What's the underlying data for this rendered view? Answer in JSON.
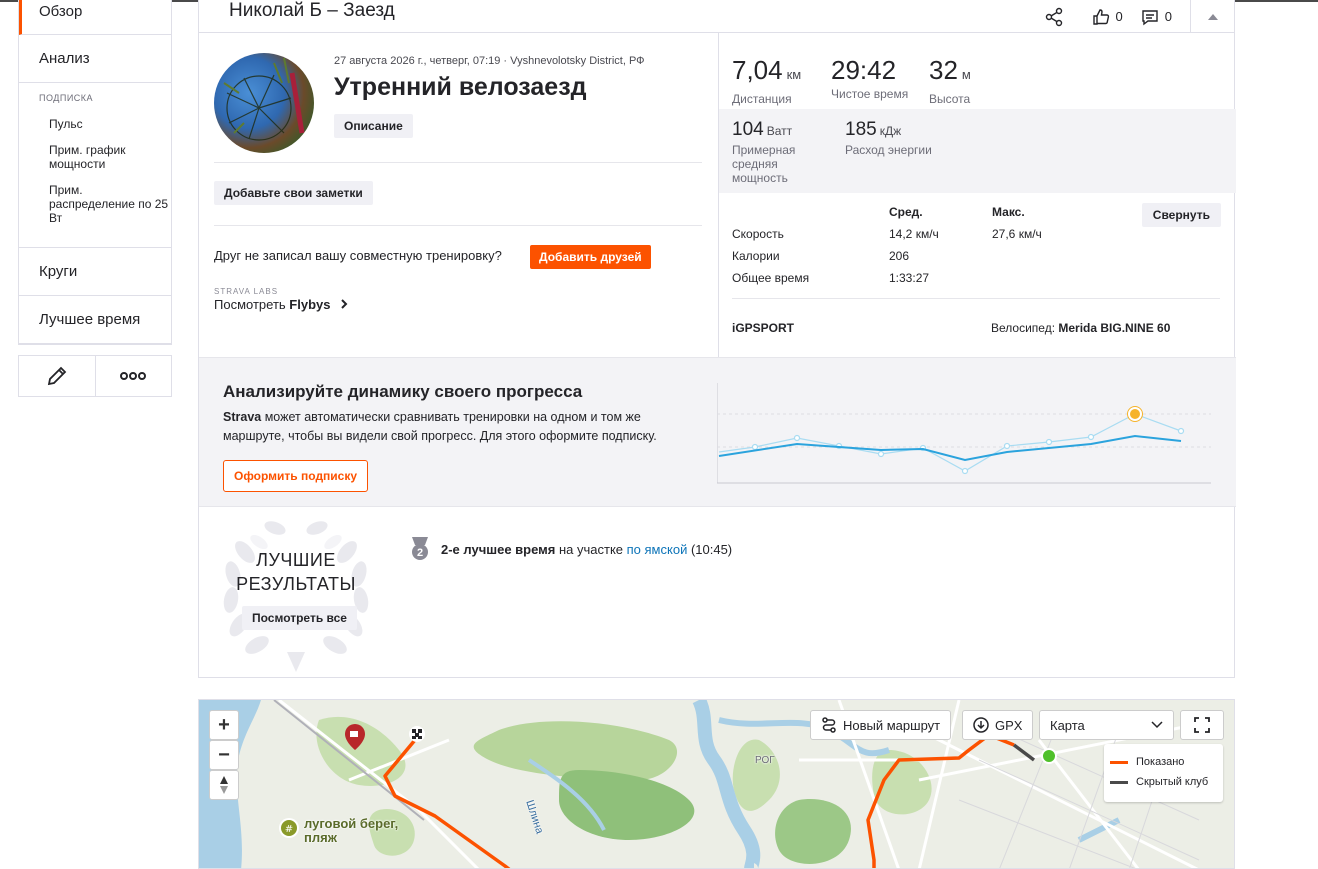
{
  "sidebar": {
    "overview": "Обзор",
    "analysis": "Анализ",
    "subscription_label": "ПОДПИСКА",
    "sub_items": [
      "Пульс",
      "Прим. график мощности",
      "Прим. распределение по 25 Вт"
    ],
    "laps": "Круги",
    "best_time": "Лучшее время"
  },
  "header": {
    "title": "Николай Б – Заезд",
    "kudos_count": "0",
    "comments_count": "0"
  },
  "activity": {
    "meta": "27 августа 2026 г., четверг, 07:19 · Vyshnevolotsky District, РФ",
    "title": "Утренний велозаезд",
    "description_btn": "Описание",
    "notes_btn": "Добавьте свои заметки",
    "friend_question": "Друг не записал вашу совместную тренировку?",
    "add_friends_btn": "Добавить друзей",
    "labs_label": "STRAVA LABS",
    "flybys_prefix": "Посмотреть ",
    "flybys_bold": "Flybys"
  },
  "stats": {
    "distance_val": "7,04",
    "distance_unit": "км",
    "distance_lbl": "Дистанция",
    "moving_val": "29:42",
    "moving_lbl": "Чистое время",
    "elev_val": "32",
    "elev_unit": "м",
    "elev_lbl": "Высота",
    "power_val": "104",
    "power_unit": "Ватт",
    "power_lbl": "Примерная средняя мощность",
    "energy_val": "185",
    "energy_unit": "кДж",
    "energy_lbl": "Расход энергии",
    "col_avg": "Сред.",
    "col_max": "Макс.",
    "collapse_btn": "Свернуть",
    "rows": [
      {
        "label": "Скорость",
        "avg": "14,2 км/ч",
        "max": "27,6 км/ч"
      },
      {
        "label": "Калории",
        "avg": "206",
        "max": ""
      },
      {
        "label": "Общее время",
        "avg": "1:33:27",
        "max": ""
      }
    ],
    "device": "iGPSPORT",
    "bike_label": "Велосипед: ",
    "bike_name": "Merida BIG.NINE 60"
  },
  "promo": {
    "title": "Анализируйте динамику своего прогресса",
    "text_bold": "Strava",
    "text_rest": " может автоматически сравнивать тренировки на одном и том же маршруте, чтобы вы видели свой прогресс. Для этого оформите подписку.",
    "button": "Оформить подписку"
  },
  "achievements": {
    "title_line1": "ЛУЧШИЕ",
    "title_line2": "РЕЗУЛЬТАТЫ",
    "view_all": "Посмотреть все",
    "rank_bold": "2-е лучшее время",
    "rank_mid": " на участке ",
    "segment": "по ямской",
    "time": " (10:45)"
  },
  "map": {
    "zoom_in": "+",
    "zoom_out": "−",
    "new_route": "Новый маршрут",
    "gpx": "GPX",
    "map_type": "Карта",
    "legend_shown": "Показано",
    "legend_hidden": "Скрытый клуб",
    "poi_label": "луговой берег, пляж",
    "river_label": "Шлина",
    "area_label": "РОГ"
  },
  "colors": {
    "accent": "#fc5200",
    "link": "#0d74b8",
    "chart_line": "#2ba3dd"
  }
}
